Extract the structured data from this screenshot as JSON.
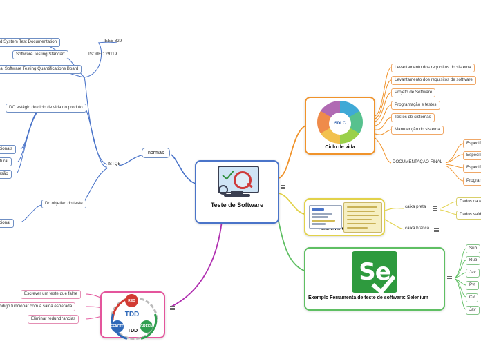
{
  "central": {
    "title": "Teste de Software",
    "icon": "monitor-magnifier-icon"
  },
  "branches": {
    "normas": {
      "label": "normas",
      "children": [
        {
          "label": "IEEE 829"
        },
        {
          "label": "ISO/IEC 29119"
        },
        {
          "label": "Software Testing Standart"
        },
        {
          "label": "Software and System Test Documentation"
        },
        {
          "label": "International Software Testing Quantifications Board"
        },
        {
          "label": "ISTQB"
        }
      ],
      "istqb_children": [
        {
          "label": "DO estágio do ciclo de vida do produto"
        },
        {
          "label": "Do objetivo do teste"
        }
      ],
      "estagio_children": [
        {
          "label": "teste funcionais"
        },
        {
          "label": "teste estrutural"
        },
        {
          "label": "teste regressão"
        }
      ],
      "objetivo_children": [
        {
          "label": "teste funcional"
        }
      ]
    },
    "ciclo_de_vida": {
      "caption": "Ciclo de vida",
      "center_label": "SDLC",
      "icon": "sdlc-donut-icon",
      "children": [
        {
          "label": "Levantamento dos requisitos do sistema"
        },
        {
          "label": "Levantamento dos requisitos de software"
        },
        {
          "label": "Projeto de Software"
        },
        {
          "label": "Programação e testes"
        },
        {
          "label": "Testes de sistemas"
        },
        {
          "label": "Manutenção do sistema"
        },
        {
          "label": "DOCUMENTAÇÃO FINAL"
        }
      ],
      "doc_children": [
        {
          "label": "Especifica"
        },
        {
          "label": "Especific"
        },
        {
          "label": "Especifica"
        },
        {
          "label": "Program"
        }
      ]
    },
    "ambiente": {
      "caption": "Ambiente considerado",
      "icon": "two-panels-icon",
      "children": [
        {
          "label": "caixa preta"
        },
        {
          "label": "caixa branca"
        }
      ],
      "caixa_preta_children": [
        {
          "label": "Dados da e"
        },
        {
          "label": "Dados saída"
        }
      ]
    },
    "selenium": {
      "caption": "Exemplo Ferramenta de teste de software: Selenium",
      "logo_text": "Se",
      "icon": "selenium-logo-icon",
      "children": [
        {
          "label": "Sub"
        },
        {
          "label": "Rub"
        },
        {
          "label": "Jav"
        },
        {
          "label": "Pyt"
        },
        {
          "label": "C#"
        },
        {
          "label": "Jav"
        }
      ]
    },
    "tdd": {
      "caption": "TDD",
      "center_label": "TDD",
      "icon": "tdd-cycle-icon",
      "bubbles": [
        {
          "label": "RED"
        },
        {
          "label": "GREEN"
        },
        {
          "label": "REFACTOR"
        }
      ],
      "children": [
        {
          "label": "Escrever um teste que falhe"
        },
        {
          "label": "o código funcionar com a saida esperada"
        },
        {
          "label": "Eliminar redund^ancias"
        }
      ]
    }
  },
  "colors": {
    "blue": "#4a74c9",
    "orange": "#f0932b",
    "yellow": "#e2d24a",
    "green": "#5fbf63",
    "pink": "#b02fb0",
    "central_border": "#4a74c9"
  }
}
